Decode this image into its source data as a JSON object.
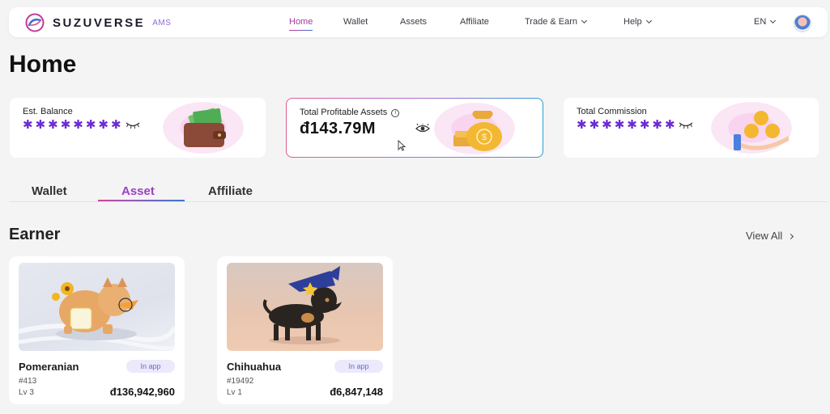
{
  "nav": {
    "brand": "SUZUVERSE",
    "brand_sub": "AMS",
    "items": [
      {
        "label": "Home",
        "active": true
      },
      {
        "label": "Wallet"
      },
      {
        "label": "Assets"
      },
      {
        "label": "Affiliate"
      },
      {
        "label": "Trade & Earn",
        "dropdown": true
      },
      {
        "label": "Help",
        "dropdown": true
      }
    ],
    "language": "EN",
    "accent": "#a23a9a"
  },
  "page": {
    "title": "Home"
  },
  "cards": {
    "balance": {
      "label": "Est. Balance",
      "hidden_value": "✱✱✱✱✱✱✱✱",
      "icon": "wallet-money"
    },
    "profitable": {
      "label": "Total Profitable Assets",
      "info": "i",
      "amount": "đ143.79M",
      "icon": "money-bag"
    },
    "commission": {
      "label": "Total Commission",
      "hidden_value": "✱✱✱✱✱✱✱✱",
      "icon": "coins-hand"
    }
  },
  "tabs": [
    {
      "label": "Wallet"
    },
    {
      "label": "Asset",
      "active": true
    },
    {
      "label": "Affiliate"
    }
  ],
  "section": {
    "title": "Earner",
    "view_all": "View All"
  },
  "nfts": [
    {
      "name": "Pomeranian",
      "badge": "In app",
      "id": "#413",
      "level": "Lv 3",
      "price": "đ136,942,960"
    },
    {
      "name": "Chihuahua",
      "badge": "In app",
      "id": "#19492",
      "level": "Lv 1",
      "price": "đ6,847,148"
    }
  ]
}
